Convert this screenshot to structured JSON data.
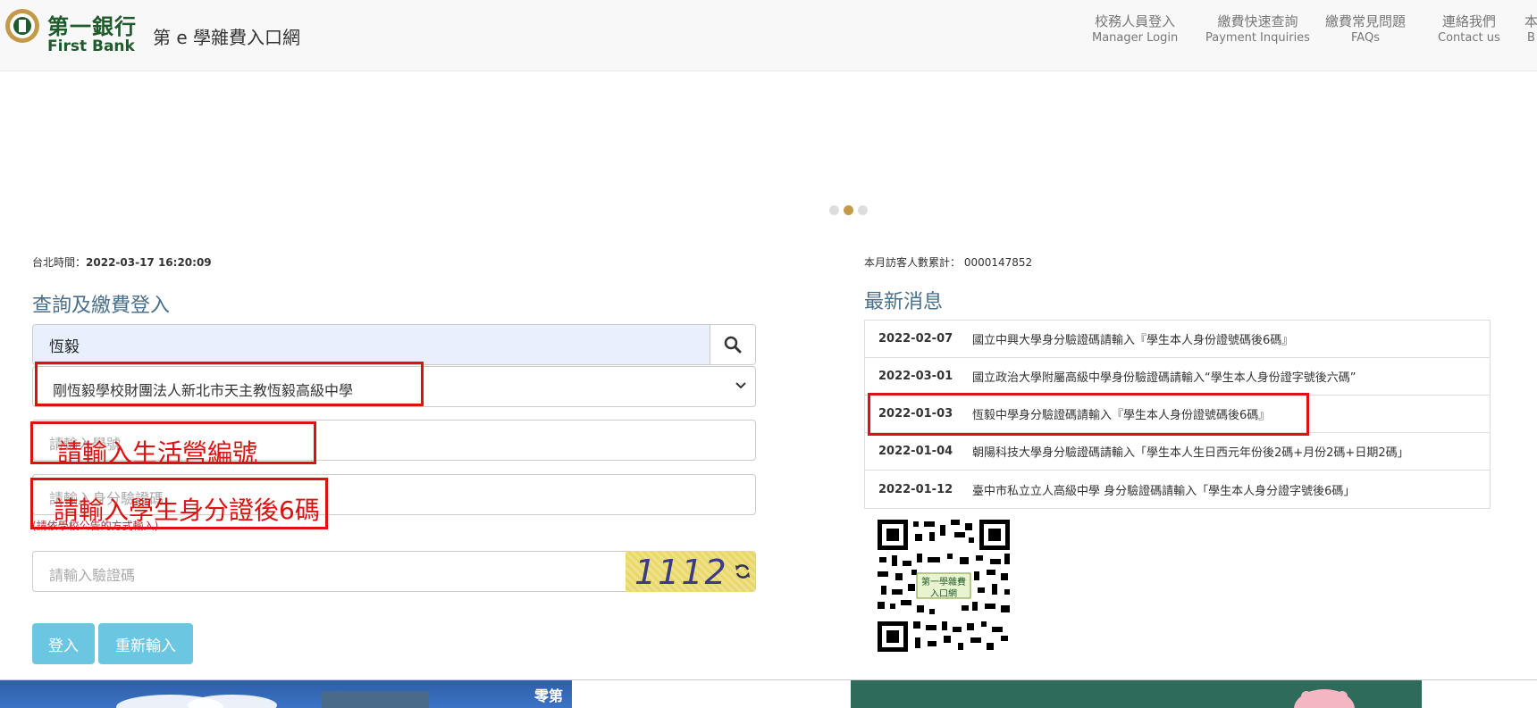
{
  "header": {
    "brand_zh": "第一銀行",
    "brand_en": "First Bank",
    "site_title": "第 e 學雜費入口網",
    "nav": [
      {
        "zh": "校務人員登入",
        "en": "Manager Login"
      },
      {
        "zh": "繳費快速查詢",
        "en": "Payment Inquiries"
      },
      {
        "zh": "繳費常見問題",
        "en": "FAQs"
      },
      {
        "zh": "連絡我們",
        "en": "Contact us"
      },
      {
        "zh": "本",
        "en": "B"
      }
    ]
  },
  "left": {
    "time_label": "台北時間：",
    "time_value": "2022-03-17 16:20:09",
    "section_title": "查詢及繳費登入",
    "search_value": "恆毅",
    "school_selected": "剛恆毅學校財團法人新北市天主教恆毅高級中學",
    "student_id_placeholder": "請輸入學號",
    "verify_placeholder": "請輸入身分驗證碼",
    "verify_note": "(請依學校公告的方式輸入)",
    "captcha_placeholder": "請輸入驗證碼",
    "captcha_text": "1112",
    "login_button": "登入",
    "reset_button": "重新輸入"
  },
  "annotations": {
    "student_id_hint": "請輸入生活營編號",
    "verify_hint": "請輸入學生身分證後6碼"
  },
  "right": {
    "visitor_label": "本月訪客人數累計：",
    "visitor_count": "0000147852",
    "news_title": "最新消息",
    "news": [
      {
        "date": "2022-02-07",
        "text": "國立中興大學身分驗證碼請輸入『學生本人身份證號碼後6碼』"
      },
      {
        "date": "2022-03-01",
        "text": "國立政治大學附屬高級中學身份驗證碼請輸入“學生本人身份證字號後六碼”"
      },
      {
        "date": "2022-01-03",
        "text": "恆毅中學身分驗證碼請輸入『學生本人身份證號碼後6碼』"
      },
      {
        "date": "2022-01-04",
        "text": "朝陽科技大學身分驗證碼請輸入「學生本人生日西元年份後2碼+月份2碼+日期2碼」"
      },
      {
        "date": "2022-01-12",
        "text": "臺中市私立立人高級中學 身分驗證碼請輸入「學生本人身分證字號後6碼」"
      }
    ],
    "qr_label_line1": "第一學雜費",
    "qr_label_line2": "入口網"
  },
  "banner": {
    "left_text": "零第"
  },
  "colors": {
    "brand_green": "#1f5a2c",
    "accent_blue": "#5bc0de",
    "annotation_red": "#d11111",
    "title_blue": "#4a6f8a"
  }
}
